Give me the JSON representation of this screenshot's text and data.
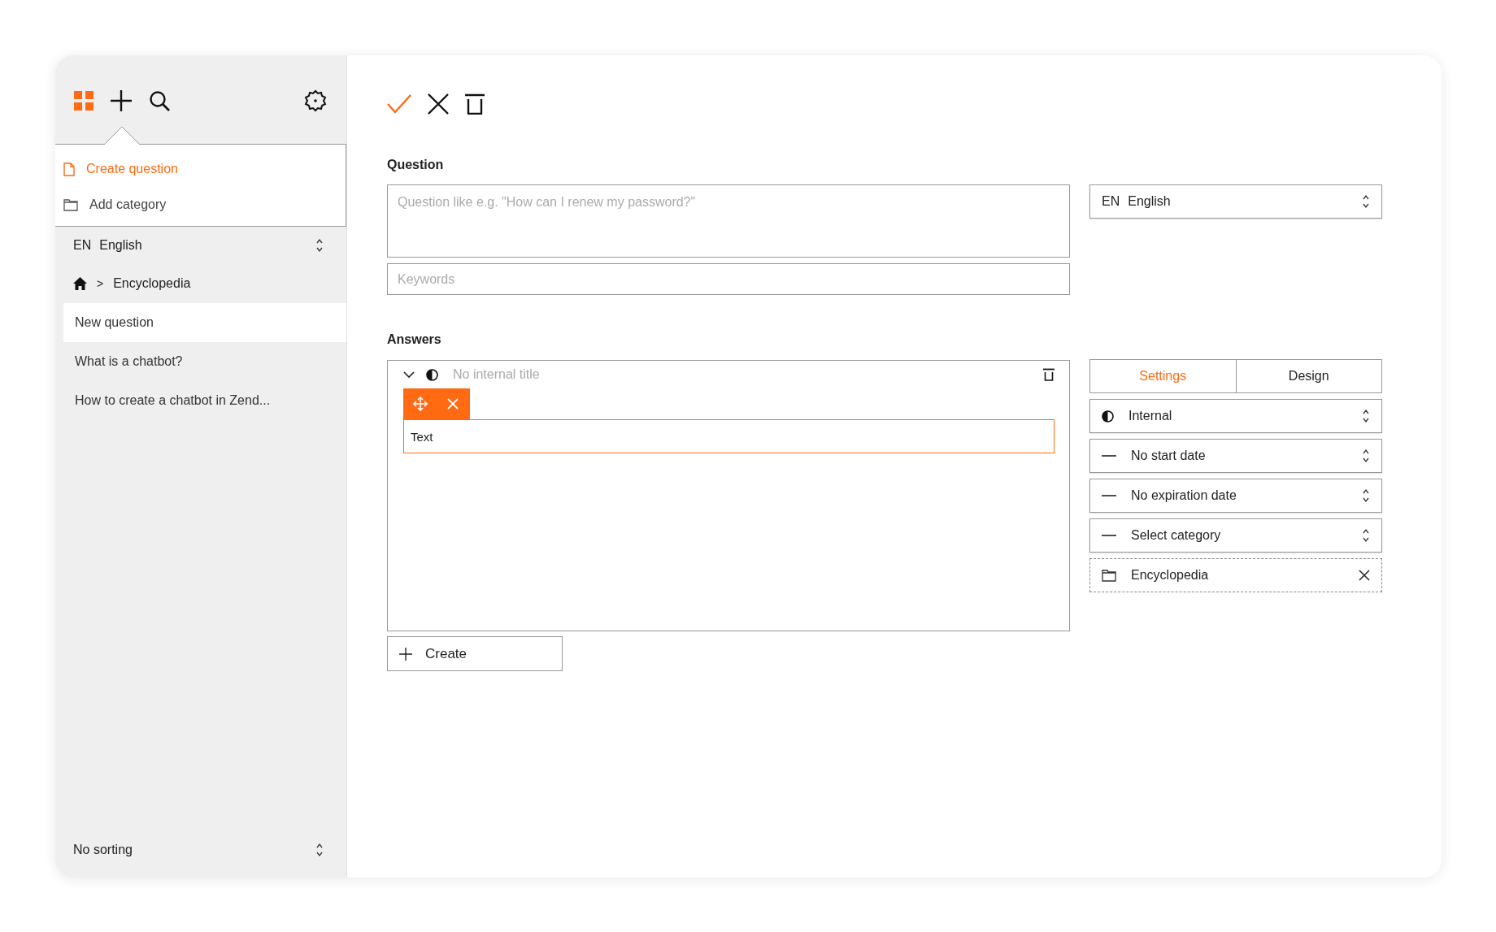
{
  "sidebar": {
    "popup_menu": [
      {
        "label": "Create question",
        "kind": "file",
        "selected": true
      },
      {
        "label": "Add category",
        "kind": "folder",
        "selected": false
      }
    ],
    "language": {
      "code": "EN",
      "name": "English"
    },
    "breadcrumb": {
      "separator": ">",
      "label": "Encyclopedia"
    },
    "items": [
      {
        "label": "New question",
        "selected": true
      },
      {
        "label": "What is a chatbot?",
        "selected": false
      },
      {
        "label": "How to create a chatbot in Zend...",
        "selected": false
      }
    ],
    "sorting": {
      "label": "No sorting"
    }
  },
  "question": {
    "label": "Question",
    "placeholder": "Question like e.g. \"How can I renew my password?\"",
    "keywords_placeholder": "Keywords",
    "language": {
      "code": "EN",
      "name": "English"
    }
  },
  "answers": {
    "label": "Answers",
    "title_placeholder": "No internal title",
    "block_text": "Text",
    "create_label": "Create"
  },
  "tabs": [
    {
      "label": "Settings",
      "selected": true
    },
    {
      "label": "Design",
      "selected": false
    }
  ],
  "settings": [
    {
      "kind": "visibility",
      "label": "Internal"
    },
    {
      "kind": "date",
      "label": "No start date"
    },
    {
      "kind": "date",
      "label": "No expiration date"
    },
    {
      "kind": "category",
      "label": "Select category"
    },
    {
      "kind": "chip",
      "label": "Encyclopedia"
    }
  ]
}
